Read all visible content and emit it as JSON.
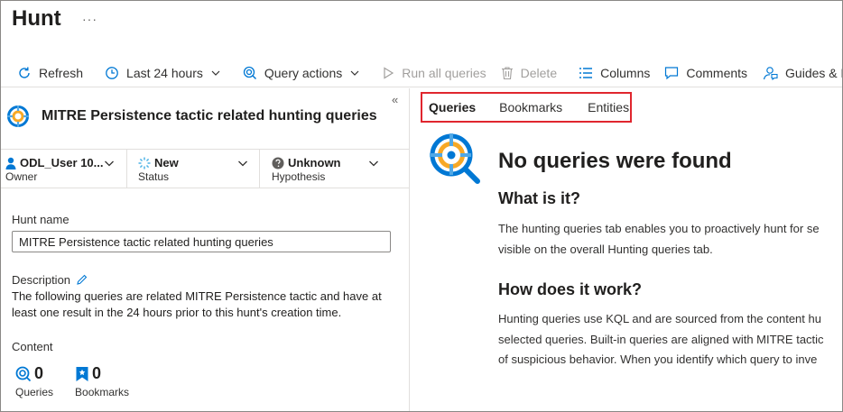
{
  "page": {
    "title": "Hunt",
    "more": "···"
  },
  "toolbar": {
    "refresh": "Refresh",
    "time_range": "Last 24 hours",
    "query_actions": "Query actions",
    "run_all": "Run all queries",
    "delete": "Delete",
    "columns": "Columns",
    "comments": "Comments",
    "guides": "Guides & Feedback"
  },
  "hunt": {
    "title": "MITRE Persistence tactic related hunting queries",
    "collapse": "«",
    "owner": {
      "value": "ODL_User 10...",
      "label": "Owner"
    },
    "status": {
      "value": "New",
      "label": "Status"
    },
    "hypothesis": {
      "value": "Unknown",
      "label": "Hypothesis"
    },
    "name_label": "Hunt name",
    "name_value": "MITRE Persistence tactic related hunting queries",
    "description_label": "Description",
    "description_line1": "The following queries are related MITRE Persistence tactic and have at",
    "description_line2": "least one result in the 24 hours prior to this hunt's creation time.",
    "content_label": "Content",
    "queries_count": "0",
    "queries_label": "Queries",
    "bookmarks_count": "0",
    "bookmarks_label": "Bookmarks"
  },
  "tabs": {
    "queries": "Queries",
    "bookmarks": "Bookmarks",
    "entities": "Entities"
  },
  "empty_state": {
    "title": "No queries were found",
    "what_heading": "What is it?",
    "what_line1": "The hunting queries tab enables you to proactively hunt for se",
    "what_line2": "visible on the overall Hunting queries tab.",
    "how_heading": "How does it work?",
    "how_line1": "Hunting queries use KQL and are sourced from the content hu",
    "how_line2": "selected queries. Built-in queries are aligned with MITRE tactic",
    "how_line3": "of suspicious behavior. When you identify which query to inve"
  },
  "colors": {
    "accent": "#0078d4",
    "highlight_border": "#e0262e",
    "icon_orange": "#f7a825"
  }
}
